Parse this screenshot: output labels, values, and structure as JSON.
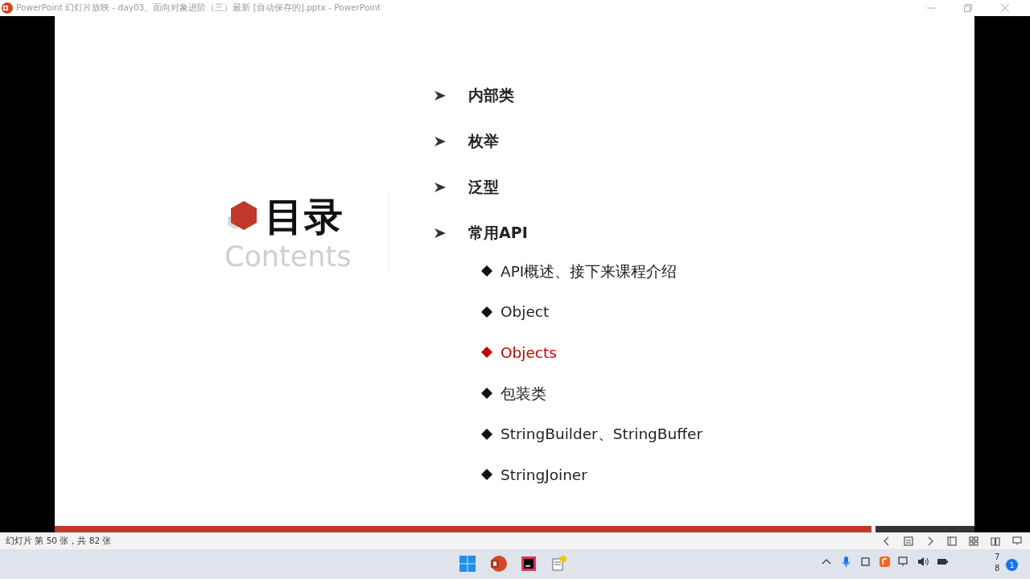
{
  "window": {
    "title": "PowerPoint 幻灯片放映 - day03、面向对象进阶（三）最新 [自动保存的].pptx - PowerPoint"
  },
  "slide": {
    "heading": "目录",
    "subheading": "Contents",
    "items": [
      {
        "label": "内部类"
      },
      {
        "label": "枚举"
      },
      {
        "label": "泛型"
      },
      {
        "label": "常用API",
        "children": [
          {
            "label": "API概述、接下来课程介绍",
            "selected": false
          },
          {
            "label": "Object",
            "selected": false
          },
          {
            "label": "Objects",
            "selected": true
          },
          {
            "label": "包装类",
            "selected": false
          },
          {
            "label": "StringBuilder、StringBuffer",
            "selected": false
          },
          {
            "label": "StringJoiner",
            "selected": false
          }
        ]
      }
    ]
  },
  "status_bar": {
    "text": "幻灯片 第 50 张，共 82 张"
  },
  "taskbar": {
    "clock": [
      "7",
      "8"
    ],
    "notification_count": "1"
  }
}
